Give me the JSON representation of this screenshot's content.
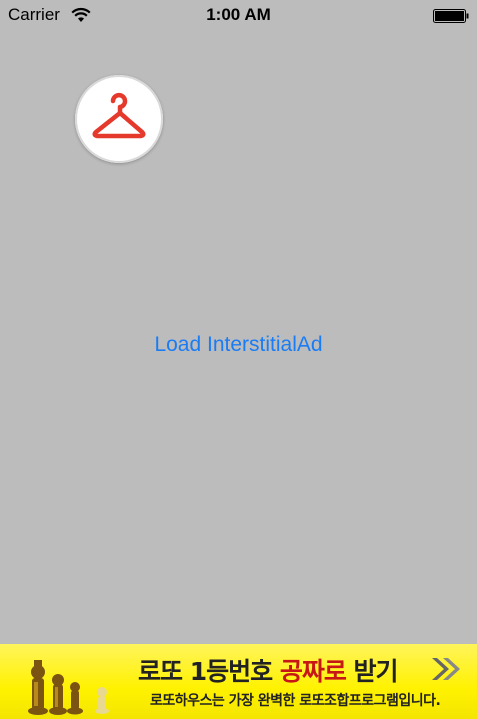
{
  "status_bar": {
    "carrier": "Carrier",
    "time": "1:00 AM"
  },
  "main": {
    "hanger_icon": "hanger-icon",
    "load_label": "Load InterstitialAd",
    "link_color": "#1a7cf5"
  },
  "banner": {
    "title_prefix": "로또 1등번호 ",
    "title_highlight": "공짜로",
    "title_suffix": " 받기",
    "subtitle": "로또하우스는 가장 완벽한 로또조합프로그램입니다.",
    "background": "#fff200"
  }
}
